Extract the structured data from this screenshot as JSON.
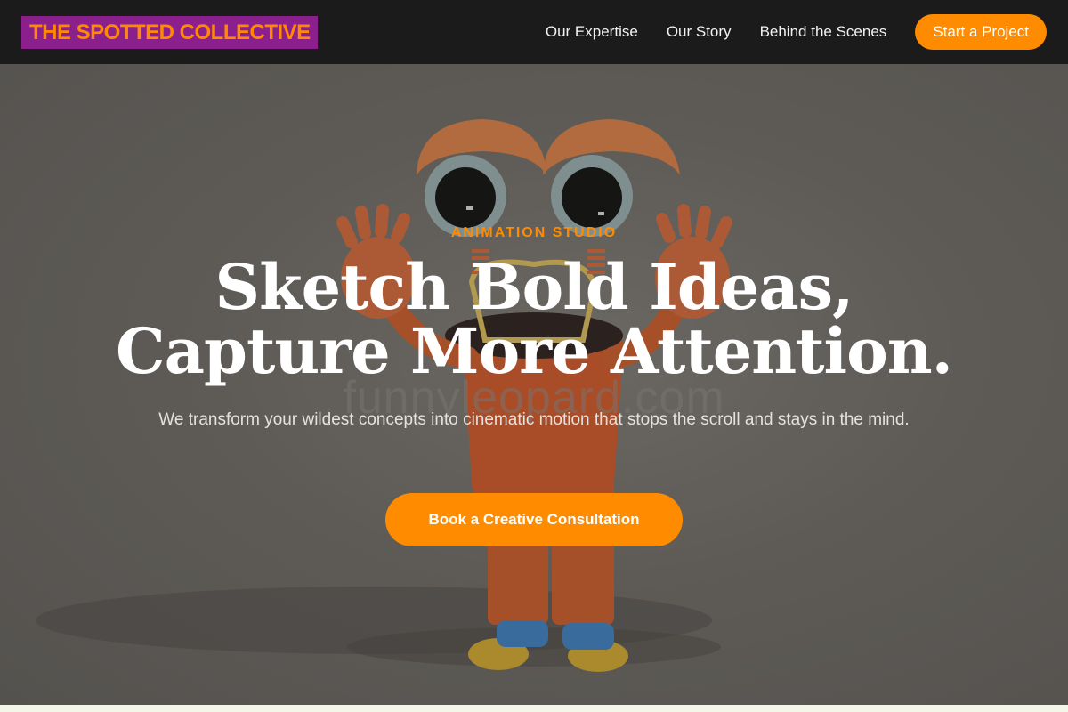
{
  "navbar": {
    "logo": "THE SPOTTED COLLECTIVE",
    "links": [
      "Our Expertise",
      "Our Story",
      "Behind the Scenes"
    ],
    "cta": "Start a Project"
  },
  "hero": {
    "eyebrow": "ANIMATION STUDIO",
    "headline_line1": "Sketch Bold Ideas,",
    "headline_line2": "Capture More Attention.",
    "subtext": "We transform your wildest concepts into cinematic motion that stops the scroll and stays in the mind.",
    "cta": "Book a Creative Consultation",
    "watermark": "funnyleopard.com"
  },
  "colors": {
    "accent": "#ff8c00",
    "nav_bg": "#1b1b1b",
    "logo_bg": "#8b1f8b"
  }
}
